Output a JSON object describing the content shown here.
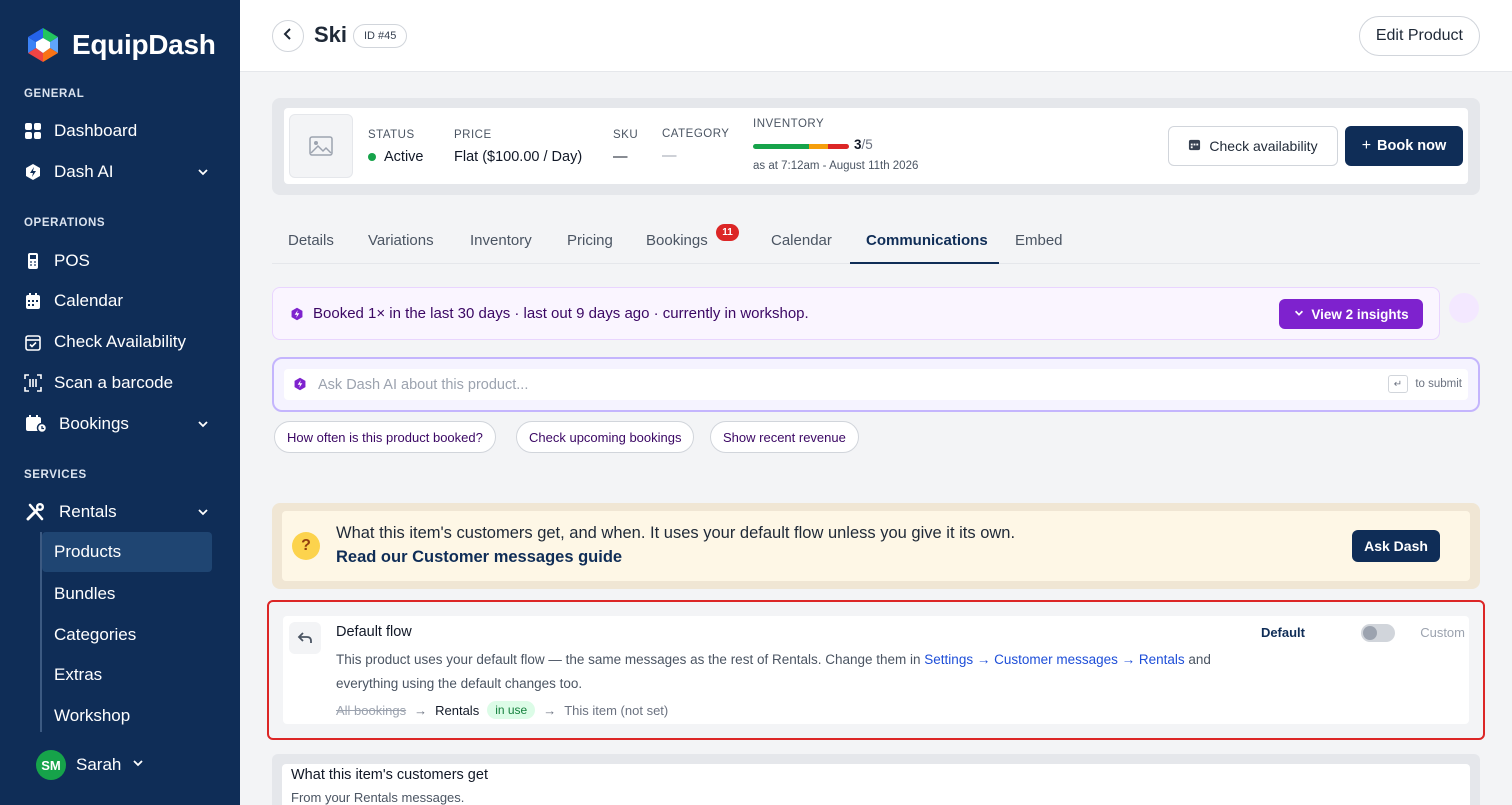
{
  "sidebar": {
    "brand": "EquipDash",
    "sections": {
      "general": "GENERAL",
      "operations": "OPERATIONS",
      "services": "SERVICES"
    },
    "items": {
      "dashboard": "Dashboard",
      "dash_ai": "Dash AI",
      "pos": "POS",
      "calendar": "Calendar",
      "check_availability": "Check Availability",
      "scan_barcode": "Scan a barcode",
      "bookings": "Bookings",
      "rentals": "Rentals"
    },
    "sub_items": [
      "Products",
      "Bundles",
      "Categories",
      "Extras",
      "Workshop"
    ],
    "user": {
      "initials": "SM",
      "name": "Sarah"
    }
  },
  "header": {
    "title": "Ski",
    "id_badge": "ID #45",
    "edit_label": "Edit Product"
  },
  "product": {
    "status_label": "STATUS",
    "status_value": "Active",
    "price_label": "PRICE",
    "price_value": "Flat ($100.00 / Day)",
    "sku_label": "SKU",
    "sku_value": "—",
    "category_label": "CATEGORY",
    "category_value": "—",
    "inventory_label": "INVENTORY",
    "inventory_count": "3",
    "inventory_total": "/5",
    "inventory_timestamp": "as at 7:12am - August 11th 2026",
    "check_availability": "Check availability",
    "book_now": "Book now"
  },
  "tabs": {
    "details": "Details",
    "variations": "Variations",
    "inventory": "Inventory",
    "pricing": "Pricing",
    "bookings": "Bookings",
    "bookings_count": "11",
    "calendar": "Calendar",
    "communications": "Communications",
    "embed": "Embed"
  },
  "insight": {
    "text": "Booked 1× in the last 30 days · last out 9 days ago · currently in workshop.",
    "button": "View  2 insights"
  },
  "ask_ai": {
    "placeholder": "Ask Dash AI about this product...",
    "submit_hint": "to submit",
    "chips": [
      "How often is this product booked?",
      "Check upcoming bookings",
      "Show recent revenue"
    ]
  },
  "banner": {
    "text": "What this item's customers get, and when. It uses your default flow unless you give it its own.",
    "link": "Read our Customer messages guide",
    "button": "Ask Dash"
  },
  "flow": {
    "title": "Default flow",
    "desc_before": "This product uses your default flow — the same messages as the rest of Rentals. Change them in ",
    "desc_link": "Settings → Customer messages → Rentals",
    "desc_after": " and everything using the default changes too.",
    "trail_all": "All bookings",
    "trail_rentals": "Rentals",
    "trail_inuse": "in use",
    "trail_item": "This item (not set)",
    "default_label": "Default",
    "custom_label": "Custom"
  },
  "customers_get": {
    "title": "What this item's customers get",
    "subtitle": "From your Rentals messages."
  },
  "colors": {
    "navy": "#0f2d57",
    "purple": "#7e22ce",
    "green": "#16a34a",
    "red": "#dc2626"
  }
}
